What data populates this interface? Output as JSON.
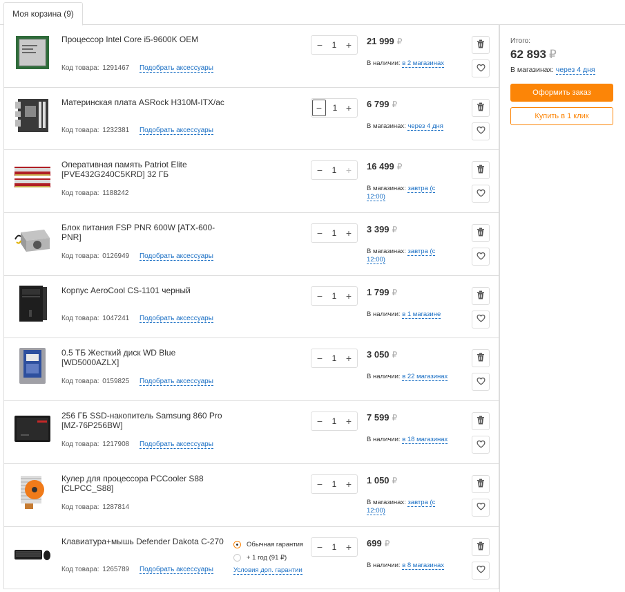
{
  "tab": {
    "label": "Моя корзина (9)"
  },
  "currency": "₽",
  "code_label": "Код товара:",
  "accessories_label": "Подобрать аксессуары",
  "items": [
    {
      "name": "Процессор Intel Core i5-9600K OEM",
      "code": "1291467",
      "qty": "1",
      "price": "21 999",
      "avail_prefix": "В наличии:",
      "avail_link": "в 2 магазинах",
      "has_accessories": true,
      "image": "cpu"
    },
    {
      "name": "Материнская плата ASRock H310M-ITX/ac",
      "code": "1232381",
      "qty": "1",
      "price": "6 799",
      "avail_prefix": "В магазинах:",
      "avail_link": "через 4 дня",
      "has_accessories": true,
      "image": "motherboard"
    },
    {
      "name": "Оперативная память Patriot Elite [PVE432G240C5KRD] 32 ГБ",
      "code": "1188242",
      "qty": "1",
      "price": "16 499",
      "avail_prefix": "В магазинах:",
      "avail_link": "завтра (с 12:00)",
      "has_accessories": false,
      "image": "ram"
    },
    {
      "name": "Блок питания FSP PNR 600W [ATX-600-PNR]",
      "code": "0126949",
      "qty": "1",
      "price": "3 399",
      "avail_prefix": "В магазинах:",
      "avail_link": "завтра (с 12:00)",
      "has_accessories": true,
      "image": "psu"
    },
    {
      "name": "Корпус AeroCool CS-1101 черный",
      "code": "1047241",
      "qty": "1",
      "price": "1 799",
      "avail_prefix": "В наличии:",
      "avail_link": "в 1 магазине",
      "has_accessories": true,
      "image": "case"
    },
    {
      "name": "0.5 ТБ Жесткий диск WD Blue [WD5000AZLX]",
      "code": "0159825",
      "qty": "1",
      "price": "3 050",
      "avail_prefix": "В наличии:",
      "avail_link": "в 22 магазинах",
      "has_accessories": true,
      "image": "hdd"
    },
    {
      "name": "256 ГБ SSD-накопитель Samsung 860 Pro [MZ-76P256BW]",
      "code": "1217908",
      "qty": "1",
      "price": "7 599",
      "avail_prefix": "В наличии:",
      "avail_link": "в 18 магазинах",
      "has_accessories": true,
      "image": "ssd"
    },
    {
      "name": "Кулер для процессора PCCooler S88 [CLPCC_S88]",
      "code": "1287814",
      "qty": "1",
      "price": "1 050",
      "avail_prefix": "В магазинах:",
      "avail_link": "завтра (с 12:00)",
      "has_accessories": false,
      "image": "cooler"
    },
    {
      "name": "Клавиатура+мышь Defender Dakota C-270",
      "code": "1265789",
      "qty": "1",
      "price": "699",
      "avail_prefix": "В наличии:",
      "avail_link": "в 8 магазинах",
      "has_accessories": true,
      "image": "keyboard"
    }
  ],
  "warranty": {
    "option_standard": "Обычная гарантия",
    "option_extended": "+ 1 год (91 ₽)",
    "terms_link": "Условия доп. гарантии"
  },
  "summary": {
    "label": "Итого:",
    "total": "62 893",
    "stores_prefix": "В магазинах:",
    "stores_link": "через 4 дня",
    "order_button": "Оформить заказ",
    "oneclick_button": "Купить в 1 клик"
  },
  "colors": {
    "accent": "#fc8507",
    "link": "#1a6fc4",
    "border": "#dddddd"
  }
}
